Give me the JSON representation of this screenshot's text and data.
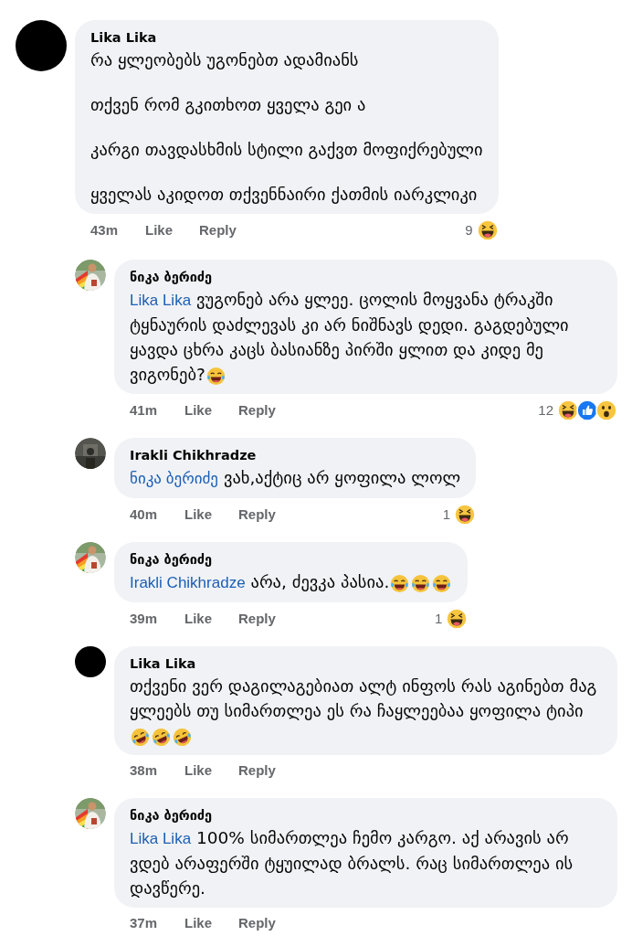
{
  "comments": [
    {
      "author": "Lika Lika",
      "avatar": {
        "kind": "plain"
      },
      "reply": false,
      "paragraphs": [
        {
          "text": "რა ყლეობებს უგონებთ ადამიანს"
        },
        {
          "text": "თქვენ რომ გკითხოთ ყველა გეი ა"
        },
        {
          "text": "კარგი თავდასხმის სტილი გაქვთ მოფიქრებული"
        },
        {
          "text": "ყველას აკიდოთ თქვენნაირი ქათმის იარკლიკი"
        }
      ],
      "time": "43m",
      "like": "Like",
      "reply_label": "Reply",
      "reaction_count": "9",
      "reactions": [
        {
          "kind": "haha"
        }
      ]
    },
    {
      "author": "ნიკა ბერიძე",
      "avatar": {
        "kind": "picture"
      },
      "reply": true,
      "paragraphs": [
        {
          "mention": "Lika Lika",
          "text": "ვუგონებ არა ყლეე. ცოლის მოყვანა ტრაკში ტყნაურის დაძლევას კი არ ნიშნავს დედი. გაგდებული ყავდა ცხრა კაცს ბასიანზე  პირში ყლით და კიდე მე ვიგონებ?",
          "emojis": [
            {
              "kind": "tears"
            }
          ]
        }
      ],
      "time": "41m",
      "like": "Like",
      "reply_label": "Reply",
      "reaction_count": "12",
      "reactions": [
        {
          "kind": "haha"
        },
        {
          "kind": "like"
        },
        {
          "kind": "wow"
        }
      ]
    },
    {
      "author": "Irakli Chikhradze",
      "avatar": {
        "kind": "picture"
      },
      "reply": true,
      "paragraphs": [
        {
          "mention": "ნიკა ბერიძე",
          "text": "ვახ,აქტიც არ ყოფილა ლოლ"
        }
      ],
      "time": "40m",
      "like": "Like",
      "reply_label": "Reply",
      "reaction_count": "1",
      "reactions": [
        {
          "kind": "haha"
        }
      ]
    },
    {
      "author": "ნიკა ბერიძე",
      "avatar": {
        "kind": "picture"
      },
      "reply": true,
      "paragraphs": [
        {
          "mention": "Irakli Chikhradze",
          "text": "არა, ძევკა პასია.",
          "emojis": [
            {
              "kind": "tears"
            },
            {
              "kind": "tears"
            },
            {
              "kind": "tears"
            }
          ]
        }
      ],
      "time": "39m",
      "like": "Like",
      "reply_label": "Reply",
      "reaction_count": "1",
      "reactions": [
        {
          "kind": "haha"
        }
      ]
    },
    {
      "author": "Lika Lika",
      "avatar": {
        "kind": "plain"
      },
      "reply": true,
      "paragraphs": [
        {
          "text": "თქვენი ვერ დაგილაგებიათ ალტ ინფოს რას აგინებთ მაგ ყლეებს თუ სიმართლეა ეს რა ჩაყლეებაა ყოფილა ტიპი ",
          "emojis": [
            {
              "kind": "rolling"
            },
            {
              "kind": "rolling"
            },
            {
              "kind": "rolling"
            }
          ]
        }
      ],
      "time": "38m",
      "like": "Like",
      "reply_label": "Reply"
    },
    {
      "author": "ნიკა ბერიძე",
      "avatar": {
        "kind": "picture"
      },
      "reply": true,
      "paragraphs": [
        {
          "mention": "Lika Lika",
          "text": "100% სიმართლეა ჩემო კარგო. აქ არავის არ ვდებ არაფერში ტყუილად ბრალს. რაც სიმართლეა ის დავწერე."
        }
      ],
      "time": "37m",
      "like": "Like",
      "reply_label": "Reply"
    }
  ]
}
